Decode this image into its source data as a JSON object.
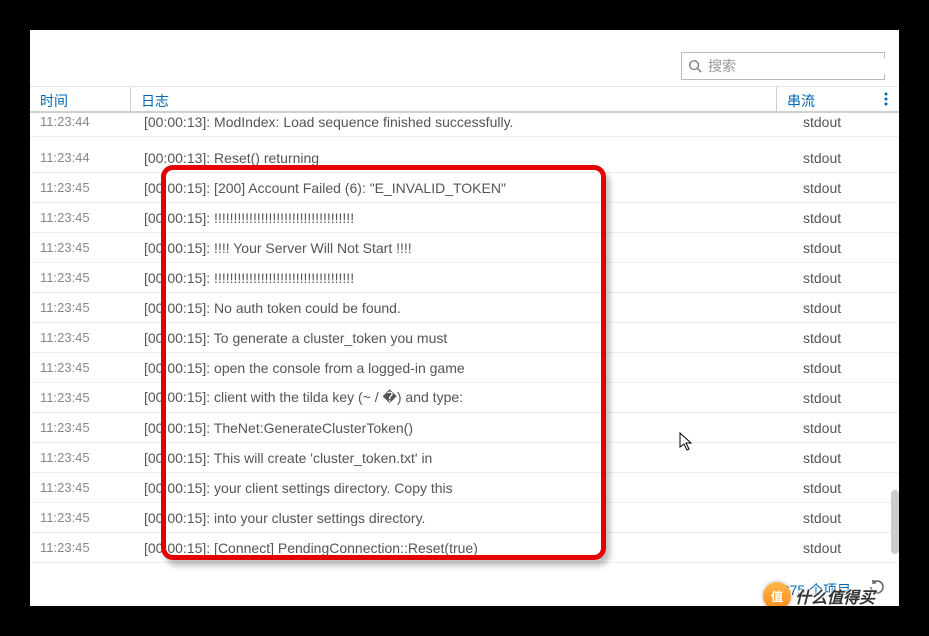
{
  "search": {
    "placeholder": "搜索"
  },
  "columns": {
    "time": "时间",
    "log": "日志",
    "stream": "串流"
  },
  "rows": [
    {
      "time": "11:23:44",
      "log": "[00:00:13]: ModIndex: Load sequence finished successfully.",
      "stream": "stdout"
    },
    {
      "time": "11:23:44",
      "log": "[00:00:13]: Reset() returning",
      "stream": "stdout"
    },
    {
      "time": "11:23:45",
      "log": "[00:00:15]: [200] Account Failed (6): \"E_INVALID_TOKEN\"",
      "stream": "stdout"
    },
    {
      "time": "11:23:45",
      "log": "[00:00:15]: !!!!!!!!!!!!!!!!!!!!!!!!!!!!!!!!!!!!",
      "stream": "stdout"
    },
    {
      "time": "11:23:45",
      "log": "[00:00:15]: !!!! Your Server Will Not Start !!!!",
      "stream": "stdout"
    },
    {
      "time": "11:23:45",
      "log": "[00:00:15]: !!!!!!!!!!!!!!!!!!!!!!!!!!!!!!!!!!!!",
      "stream": "stdout"
    },
    {
      "time": "11:23:45",
      "log": "[00:00:15]: No auth token could be found.",
      "stream": "stdout"
    },
    {
      "time": "11:23:45",
      "log": "[00:00:15]: To generate a cluster_token you must",
      "stream": "stdout"
    },
    {
      "time": "11:23:45",
      "log": "[00:00:15]: open the console from a logged-in game",
      "stream": "stdout"
    },
    {
      "time": "11:23:45",
      "log": "[00:00:15]: client with the tilda key (~ / �) and type:",
      "stream": "stdout"
    },
    {
      "time": "11:23:45",
      "log": "[00:00:15]: TheNet:GenerateClusterToken()",
      "stream": "stdout"
    },
    {
      "time": "11:23:45",
      "log": "[00:00:15]: This will create 'cluster_token.txt' in",
      "stream": "stdout"
    },
    {
      "time": "11:23:45",
      "log": "[00:00:15]: your client settings directory. Copy this",
      "stream": "stdout"
    },
    {
      "time": "11:23:45",
      "log": "[00:00:15]: into your cluster settings directory.",
      "stream": "stdout"
    },
    {
      "time": "11:23:45",
      "log": "[00:00:15]: [Connect] PendingConnection::Reset(true)",
      "stream": "stdout"
    }
  ],
  "footer": {
    "count_text": "375 个项目"
  },
  "watermark": {
    "badge": "值",
    "text": "什么值得买"
  }
}
